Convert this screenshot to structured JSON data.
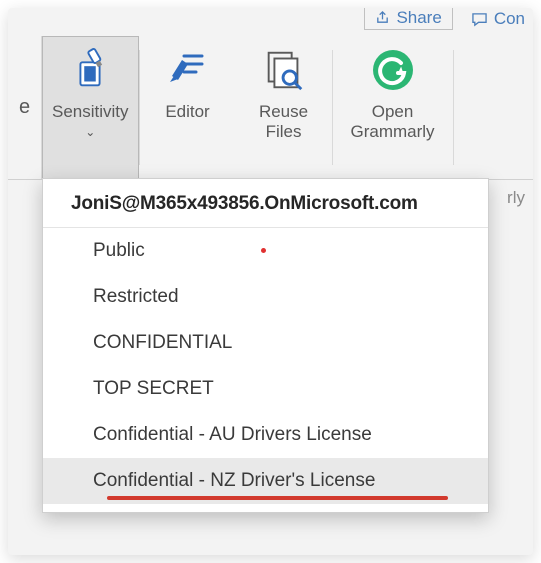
{
  "topstrip": {
    "share_label": "Share",
    "comments_label": "Con"
  },
  "ribbon": {
    "lead_char": "e",
    "sensitivity": {
      "label": "Sensitivity"
    },
    "editor": {
      "label": "Editor"
    },
    "reuse_files": {
      "label": "Reuse\nFiles"
    },
    "grammarly": {
      "label": "Open\nGrammarly"
    },
    "truncated_suffix": "rly"
  },
  "dropdown": {
    "account": "JoniS@M365x493856.OnMicrosoft.com",
    "items": [
      {
        "label": "Public",
        "dot": true
      },
      {
        "label": "Restricted"
      },
      {
        "label": "CONFIDENTIAL"
      },
      {
        "label": "TOP SECRET"
      },
      {
        "label": "Confidential - AU Drivers License"
      },
      {
        "label": "Confidential - NZ Driver's License",
        "hover": true
      }
    ]
  },
  "colors": {
    "accent_blue": "#2f6bbd",
    "grammarly_green": "#2bb673",
    "red_underline": "#d23a2e"
  }
}
